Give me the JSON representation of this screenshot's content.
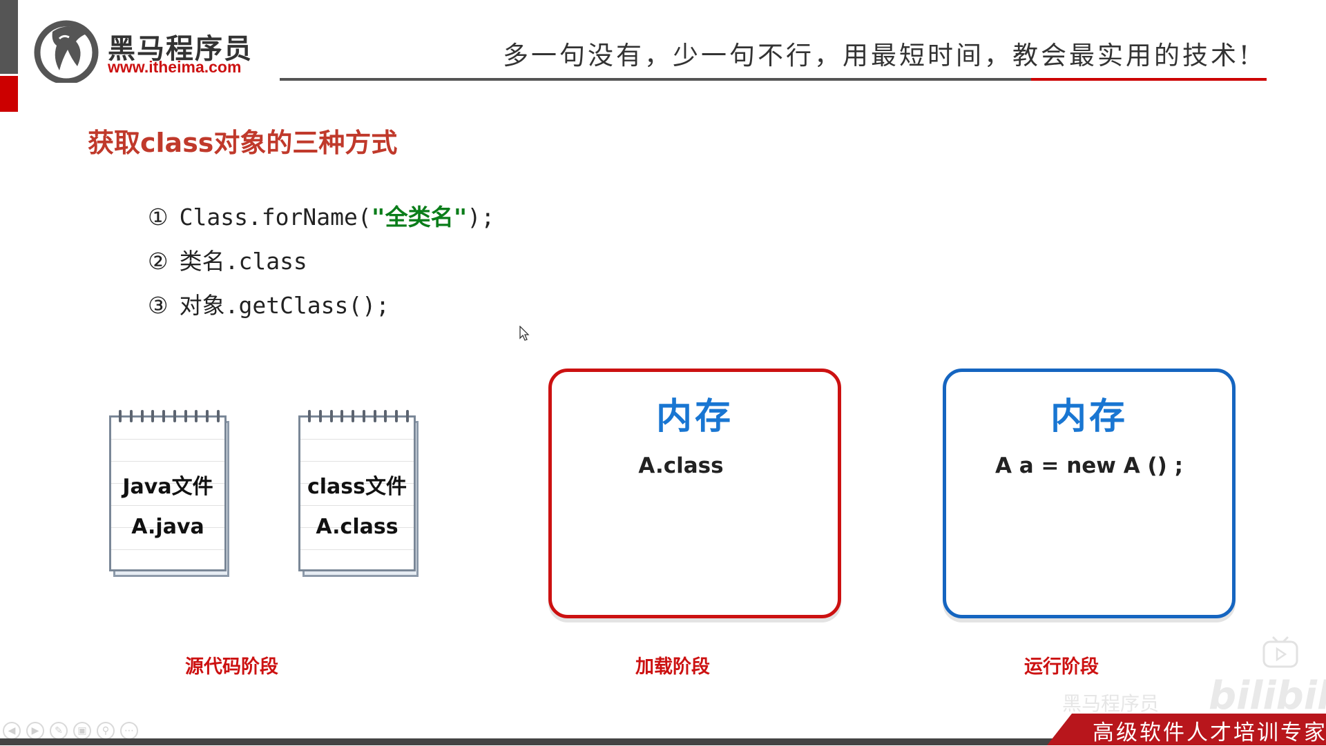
{
  "brand": {
    "name": "黑马程序员",
    "url": "www.itheima.com"
  },
  "header": {
    "slogan": "多一句没有，少一句不行，用最短时间，教会最实用的技术!"
  },
  "slide": {
    "title": "获取class对象的三种方式",
    "methods": [
      {
        "marker": "①",
        "code_before": "Class.forName(",
        "code_highlight": "\"全类名\"",
        "code_after": ");"
      },
      {
        "marker": "②",
        "code": "类名.class"
      },
      {
        "marker": "③",
        "code": "对象.getClass();"
      }
    ]
  },
  "notebooks": [
    {
      "line1": "Java文件",
      "line2": "A.java"
    },
    {
      "line1": "class文件",
      "line2": "A.class"
    }
  ],
  "memory_boxes": [
    {
      "title": "内存",
      "content": "A.class",
      "border_color": "#cc1111"
    },
    {
      "title": "内存",
      "content": "A a =  new A () ;",
      "border_color": "#1565c0"
    }
  ],
  "stages": {
    "source": "源代码阶段",
    "load": "加载阶段",
    "run": "运行阶段"
  },
  "footer": {
    "banner": "高级软件人才培训专家",
    "watermark_brand": "黑马程序员",
    "watermark_site": "bilibili"
  },
  "toolbar": {
    "icons": [
      "prev-icon",
      "next-icon",
      "pen-icon",
      "slides-icon",
      "zoom-icon",
      "more-icon"
    ]
  },
  "colors": {
    "accent_red": "#cc1111",
    "accent_blue": "#1565c0",
    "title_red": "#c0392b",
    "code_green": "#0a7d1a"
  }
}
